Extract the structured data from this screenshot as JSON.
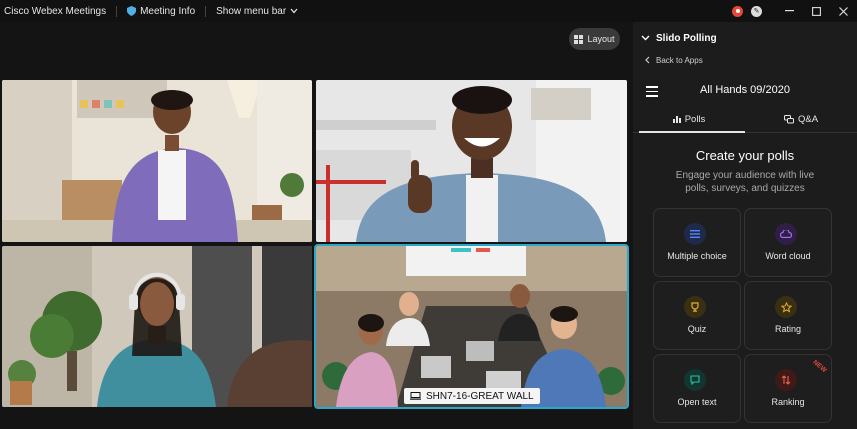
{
  "titlebar": {
    "app_name": "Cisco Webex Meetings",
    "meeting_info": "Meeting Info",
    "show_menu_bar": "Show menu bar"
  },
  "stage": {
    "layout_label": "Layout",
    "active_tile_name": "SHN7-16-GREAT WALL"
  },
  "panel": {
    "title": "Slido Polling",
    "back_label": "Back to Apps",
    "event_title": "All Hands 09/2020",
    "tabs": [
      {
        "label": "Polls",
        "active": true
      },
      {
        "label": "Q&A",
        "active": false
      }
    ],
    "create_title": "Create your polls",
    "create_subtitle": "Engage your audience with live polls, surveys, and quizzes",
    "cards": [
      {
        "label": "Multiple choice",
        "icon": "list-icon",
        "color": "#3b6ef0"
      },
      {
        "label": "Word cloud",
        "icon": "cloud-icon",
        "color": "#8f4fe8"
      },
      {
        "label": "Quiz",
        "icon": "trophy-icon",
        "color": "#d4a017"
      },
      {
        "label": "Rating",
        "icon": "star-icon",
        "color": "#d4a017"
      },
      {
        "label": "Open text",
        "icon": "chat-icon",
        "color": "#1fa58f"
      },
      {
        "label": "Ranking",
        "icon": "ranking-icon",
        "color": "#e04b3a",
        "badge": "NEW"
      }
    ]
  },
  "colors": {
    "active_border": "#2aa7c9",
    "record": "#e5483a",
    "panel_bg": "#1c1c1c"
  }
}
